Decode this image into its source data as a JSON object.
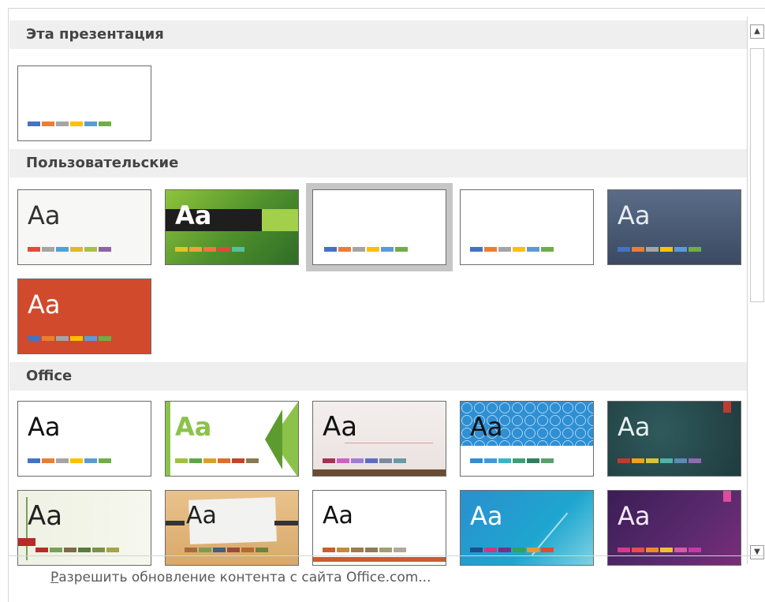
{
  "sections": {
    "this_presentation": "Эта презентация",
    "custom": "Пользовательские",
    "office": "Office"
  },
  "thumb_text": "Aa",
  "footer": {
    "underlined_letter": "Р",
    "link_text": "азрешить обновление контента с сайта Office.com..."
  },
  "scroll": {
    "up_icon": "▲",
    "down_icon": "▼"
  },
  "palettes": {
    "office": [
      "#4472c4",
      "#ed7d31",
      "#a5a5a5",
      "#ffc000",
      "#5b9bd5",
      "#70ad47"
    ],
    "custom1": [
      "#e04b3c",
      "#a5a5a5",
      "#4aa3d9",
      "#e2b72d",
      "#a9c23f",
      "#8e63a8"
    ],
    "custom2": [
      "#e2c32c",
      "#f0a13d",
      "#f2743e",
      "#e4463e",
      "#4fc3a0"
    ],
    "office_green": [
      "#a0c23a",
      "#5aa84b",
      "#d8a324",
      "#e46b2a",
      "#c44227",
      "#8a7a4f"
    ],
    "office_brown": [
      "#a72f58",
      "#d05fc6",
      "#9f7cd7",
      "#5f6bc3",
      "#7d88a1",
      "#6a9aa7"
    ],
    "office_blue": [
      "#2f8fd3",
      "#4398db",
      "#35b7c7",
      "#3f9e7a",
      "#2f7f5e",
      "#5aa06a"
    ],
    "office_teal": [
      "#c13a32",
      "#f0a21c",
      "#d9c33a",
      "#53b2a4",
      "#5c8bb6",
      "#8f6bb0"
    ],
    "office_ion": [
      "#b62c29",
      "#7a9f57",
      "#7f6a44",
      "#567c3c",
      "#7c924a",
      "#a7a545"
    ],
    "office_wood": [
      "#a76a3d",
      "#7f9a54",
      "#3f5f7f",
      "#9a4a3a",
      "#b36b2f",
      "#6f7f3f"
    ],
    "office_plain": [
      "#cc5c2c",
      "#c48a3a",
      "#a07a4a",
      "#8e7b58",
      "#9f9f72",
      "#b0a89a"
    ],
    "office_cyan": [
      "#1f4e8c",
      "#d63384",
      "#7a2f87",
      "#2fa35a",
      "#f0962b",
      "#e04b2c"
    ],
    "office_purple": [
      "#d63a8a",
      "#f04a4a",
      "#f08a2a",
      "#f0c22a",
      "#d65aa8",
      "#c43aa8"
    ]
  },
  "colors": {
    "section_bg": "#efefef",
    "border": "#6b6b6b",
    "selected_outline": "#c6c6c6"
  }
}
